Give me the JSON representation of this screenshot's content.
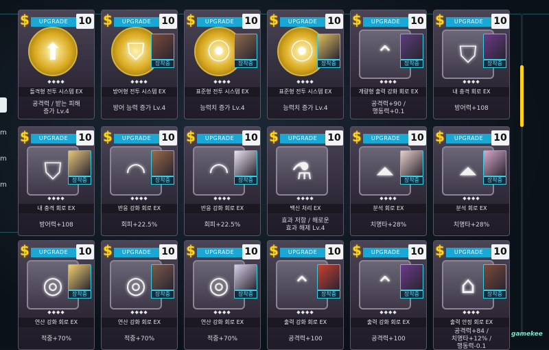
{
  "side": {
    "labels": [
      "m",
      "m",
      "m"
    ]
  },
  "common": {
    "upgrade_label": "UPGRADE",
    "level": "10",
    "equipped_label": "장착중",
    "stars": "◆◆◆◆",
    "wrench": "$"
  },
  "portrait_colors": [
    "#6b3a8a",
    "#7d4a3a",
    "#8b6a4a",
    "#e0c060",
    "#5b3d7a",
    "#6a3a8a",
    "#e6c67a",
    "#9a6a4a",
    "#e8e4f0",
    "#8a6a5a",
    "#e8d0c8",
    "#d8a8c8",
    "#f0d070",
    "#7a5a4a",
    "#d8d0e8",
    "#c84030"
  ],
  "cards": [
    {
      "name": "돌격형 전투 시스템 EX",
      "effect": "공격력 / 받는 피해\n증가 Lv.4",
      "symbol": "⬆",
      "gold": true,
      "equipped": false
    },
    {
      "name": "방어형 전투 시스템 EX",
      "effect": "방어 능력 증가 Lv.4",
      "symbol": "⛉",
      "gold": true,
      "equipped": true
    },
    {
      "name": "표준형 전투 시스템 EX",
      "effect": "능력치 증가 Lv.4",
      "symbol": "⦿",
      "gold": true,
      "equipped": true
    },
    {
      "name": "표준형 전투 시스템 EX",
      "effect": "능력치 증가 Lv.4",
      "symbol": "⦿",
      "gold": true,
      "equipped": true
    },
    {
      "name": "개량형 출력 강화 회로 EX",
      "effect": "공격력+90 /\n행동력+0.1",
      "symbol": "⌃",
      "gold": false,
      "equipped": true
    },
    {
      "name": "내 충격 회로 EX",
      "effect": "방어력+108",
      "symbol": "⛉",
      "gold": false,
      "equipped": true
    },
    {
      "name": "내 충격 회로 EX",
      "effect": "방어력+108",
      "symbol": "⛉",
      "gold": false,
      "equipped": true
    },
    {
      "name": "반응 강화 회로 EX",
      "effect": "회피+22.5%",
      "symbol": "◠",
      "gold": false,
      "equipped": true
    },
    {
      "name": "반응 강화 회로 EX",
      "effect": "회피+22.5%",
      "symbol": "◠",
      "gold": false,
      "equipped": true
    },
    {
      "name": "백신 처리 EX",
      "effect": "효과 저항 / 해로운\n효과 해제 Lv.4",
      "symbol": "⚗",
      "gold": false,
      "equipped": false
    },
    {
      "name": "분석 회로 EX",
      "effect": "치명타+28%",
      "symbol": "⏶",
      "gold": false,
      "equipped": true
    },
    {
      "name": "분석 회로 EX",
      "effect": "치명타+28%",
      "symbol": "⏶",
      "gold": false,
      "equipped": true
    },
    {
      "name": "연산 강화 회로 EX",
      "effect": "적중+70%",
      "symbol": "◎",
      "gold": false,
      "equipped": true
    },
    {
      "name": "연산 강화 회로 EX",
      "effect": "적중+70%",
      "symbol": "◎",
      "gold": false,
      "equipped": true
    },
    {
      "name": "연산 강화 회로 EX",
      "effect": "적중+70%",
      "symbol": "◎",
      "gold": false,
      "equipped": true
    },
    {
      "name": "출력 강화 회로 EX",
      "effect": "공격력+100",
      "symbol": "⌃",
      "gold": false,
      "equipped": true
    },
    {
      "name": "출력 강화 회로 EX",
      "effect": "공격력+100",
      "symbol": "⌃",
      "gold": false,
      "equipped": true
    },
    {
      "name": "출력 안정 회로 EX",
      "effect": "공격력+84 /\n치명타+12% /\n행동력-0.1",
      "symbol": "⌂",
      "gold": false,
      "equipped": true
    }
  ],
  "watermark": "gamekee"
}
